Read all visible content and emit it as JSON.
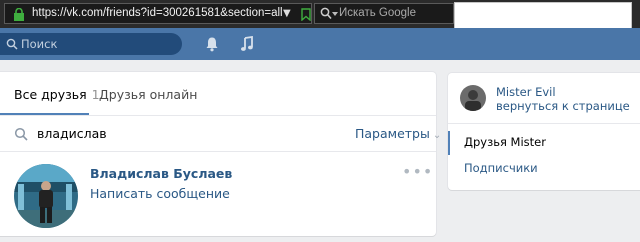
{
  "browser": {
    "url": "https://vk.com/friends?id=300261581&section=all",
    "search_placeholder": "Искать Google"
  },
  "header": {
    "search_placeholder": "Поиск"
  },
  "tabs": {
    "all_label": "Все друзья",
    "all_count": "1",
    "online_label": "Друзья онлайн"
  },
  "search": {
    "query": "владислав",
    "params_label": "Параметры"
  },
  "friend": {
    "name": "Владислав Буслаев",
    "message_link": "Написать сообщение",
    "more": "•••"
  },
  "sidebar": {
    "user_name": "Mister Evil",
    "back_link": "вернуться к странице",
    "items": [
      {
        "label": "Друзья Mister",
        "active": true
      },
      {
        "label": "Подписчики",
        "active": false
      }
    ]
  },
  "colors": {
    "header": "#4a76a8",
    "link": "#2a5885",
    "accent": "#5181b8"
  }
}
